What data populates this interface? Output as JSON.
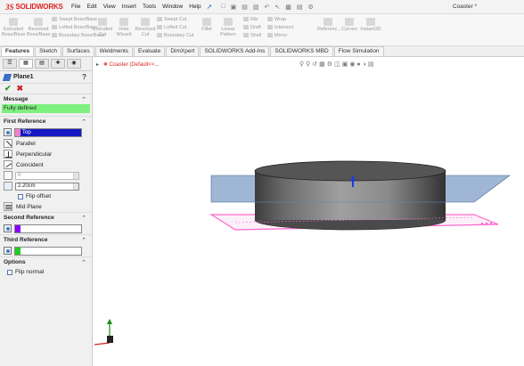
{
  "titlebar": {
    "logo_ds": "3S",
    "logo_sw": "SOLIDWORKS",
    "menu": [
      "File",
      "Edit",
      "View",
      "Insert",
      "Tools",
      "Window",
      "Help"
    ],
    "doc_title": "Coaster *"
  },
  "ribbon": {
    "extruded": "Extruded Boss/Base",
    "revolved": "Revolved Boss/Base",
    "swept_boss": "Swept Boss/Base",
    "lofted_boss": "Lofted Boss/Base",
    "boundary_boss": "Boundary Boss/Base",
    "extruded_cut": "Extruded Cut",
    "hole_wizard": "Hole Wizard",
    "revolved_cut": "Revolved Cut",
    "swept_cut": "Swept Cut",
    "lofted_cut": "Lofted Cut",
    "boundary_cut": "Boundary Cut",
    "fillet": "Fillet",
    "linear_pattern": "Linear Pattern",
    "rib": "Rib",
    "draft": "Draft",
    "shell": "Shell",
    "wrap": "Wrap",
    "intersect": "Intersect",
    "mirror": "Mirror",
    "reference": "Referenc...",
    "curves": "Curves",
    "instant3d": "Instant3D"
  },
  "tabs": [
    "Features",
    "Sketch",
    "Surfaces",
    "Weldments",
    "Evaluate",
    "DimXpert",
    "SOLIDWORKS Add-Ins",
    "SOLIDWORKS MBD",
    "Flow Simulation"
  ],
  "panel": {
    "title": "Plane1",
    "help": "?",
    "message_header": "Message",
    "message_text": "Fully defined",
    "first_ref_header": "First Reference",
    "first_ref_value": "Top",
    "options_list": [
      "Parallel",
      "Perpendicular",
      "Coincident"
    ],
    "angle_value": "0",
    "offset_value": "2.20cm",
    "flip_offset": "Flip offset",
    "mid_plane": "Mid Plane",
    "second_ref_header": "Second Reference",
    "third_ref_header": "Third Reference",
    "options_header": "Options",
    "flip_normal": "Flip normal"
  },
  "viewport": {
    "breadcrumb": "Coaster (Default<<..."
  },
  "colors": {
    "first_ref_swatch": "#f080c8",
    "second_ref_swatch": "#8800ff",
    "third_ref_swatch": "#22cc22",
    "message_bg": "#7ef07e",
    "plane_fill": "#5f86b8",
    "preview_outline": "#ff66cc"
  }
}
